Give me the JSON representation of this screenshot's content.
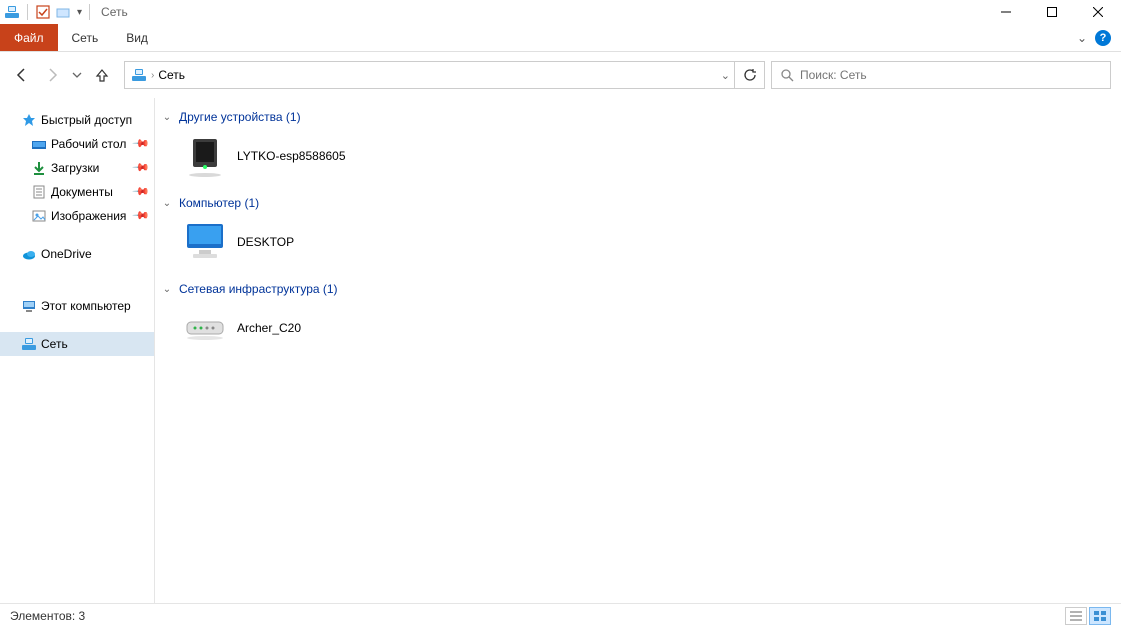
{
  "title": "Сеть",
  "ribbon": {
    "tabs": {
      "file": "Файл",
      "network": "Сеть",
      "view": "Вид"
    }
  },
  "nav": {
    "breadcrumb": "Сеть"
  },
  "search": {
    "placeholder": "Поиск: Сеть"
  },
  "sidebar": {
    "quick_access": "Быстрый доступ",
    "desktop": "Рабочий стол",
    "downloads": "Загрузки",
    "documents": "Документы",
    "pictures": "Изображения",
    "onedrive": "OneDrive",
    "this_pc": "Этот компьютер",
    "network": "Сеть"
  },
  "groups": [
    {
      "name": "Другие устройства (1)",
      "items": [
        {
          "label": "LYTKO-esp8588605",
          "icon": "device"
        }
      ]
    },
    {
      "name": "Компьютер (1)",
      "items": [
        {
          "label": "DESKTOP",
          "icon": "computer"
        }
      ]
    },
    {
      "name": "Сетевая инфраструктура (1)",
      "items": [
        {
          "label": "Archer_C20",
          "icon": "router"
        }
      ]
    }
  ],
  "status": {
    "text": "Элементов: 3"
  }
}
